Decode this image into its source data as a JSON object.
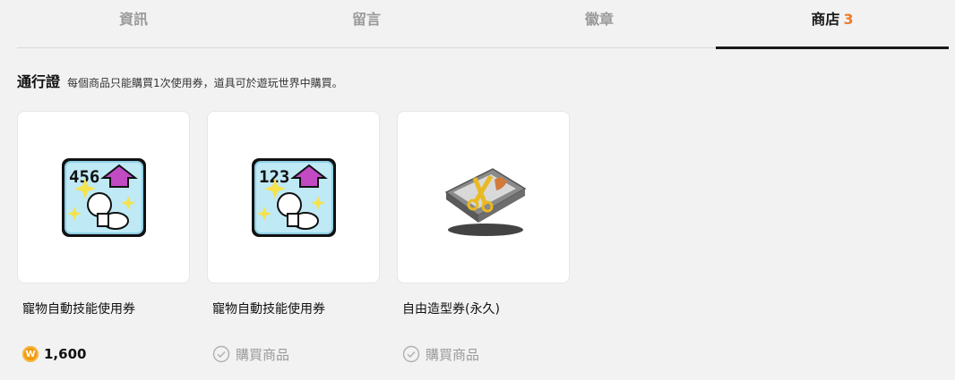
{
  "tabs": [
    {
      "label": "資訊"
    },
    {
      "label": "留言"
    },
    {
      "label": "徽章"
    },
    {
      "label": "商店",
      "count": "3"
    }
  ],
  "section": {
    "title": "通行證",
    "description": "每個商品只能購買1次使用券，道具可於遊玩世界中購買。"
  },
  "items": [
    {
      "name": "寵物自動技能使用券",
      "icon": "pet-auto-skill-ticket-456-icon",
      "number_label": "456",
      "price": "1,600",
      "currency_icon": "w-coin-icon"
    },
    {
      "name": "寵物自動技能使用券",
      "icon": "pet-auto-skill-ticket-123-icon",
      "number_label": "123",
      "buy_label": "購買商品"
    },
    {
      "name": "自由造型券(永久)",
      "icon": "free-style-coupon-icon",
      "buy_label": "購買商品"
    }
  ],
  "coin_letter": "W",
  "colors": {
    "accent": "#f07a2a",
    "coin": "#f29b12",
    "muted": "#9a9a9a"
  }
}
